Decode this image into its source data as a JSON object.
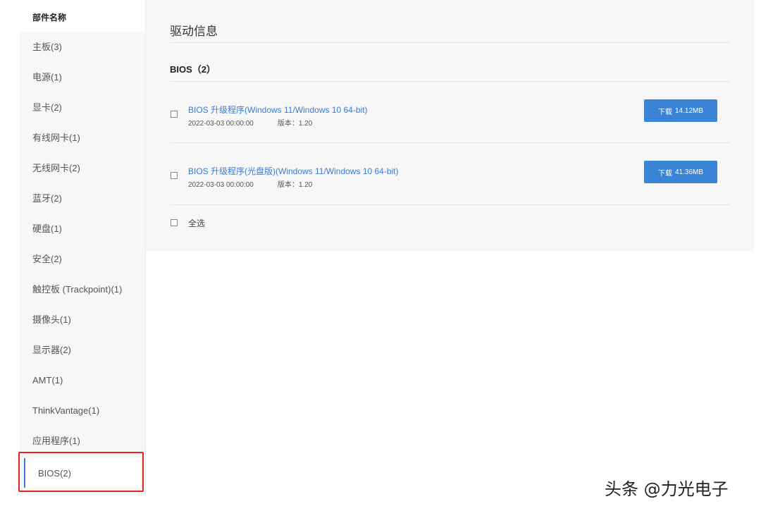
{
  "sidebar": {
    "header": "部件名称",
    "items": [
      {
        "label": "主板(3)"
      },
      {
        "label": "电源(1)"
      },
      {
        "label": "显卡(2)"
      },
      {
        "label": "有线网卡(1)"
      },
      {
        "label": "无线网卡(2)"
      },
      {
        "label": "蓝牙(2)"
      },
      {
        "label": "硬盘(1)"
      },
      {
        "label": "安全(2)"
      },
      {
        "label": "触控板 (Trackpoint)(1)"
      },
      {
        "label": "摄像头(1)"
      },
      {
        "label": "显示器(2)"
      },
      {
        "label": "AMT(1)"
      },
      {
        "label": "ThinkVantage(1)"
      },
      {
        "label": "应用程序(1)"
      },
      {
        "label": "BIOS(2)"
      }
    ],
    "active_item": "BIOS(2)"
  },
  "main": {
    "title": "驱动信息",
    "section_title": "BIOS（2）",
    "drivers": [
      {
        "name": "BIOS 升级程序(Windows 11/Windows 10 64-bit)",
        "date": "2022-03-03 00:00:00",
        "version": "版本：1.20",
        "download_label": "下载",
        "size": "14.12MB"
      },
      {
        "name": "BIOS 升级程序(光盘版)(Windows 11/Windows 10 64-bit)",
        "date": "2022-03-03 00:00:00",
        "version": "版本：1.20",
        "download_label": "下载",
        "size": "41.36MB"
      }
    ],
    "select_all_label": "全选"
  },
  "watermark": "头条 @力光电子",
  "colors": {
    "accent": "#3a84d8",
    "link": "#3a7bd5",
    "highlight_border": "#e02424",
    "panel_bg": "#f7f7f7"
  }
}
